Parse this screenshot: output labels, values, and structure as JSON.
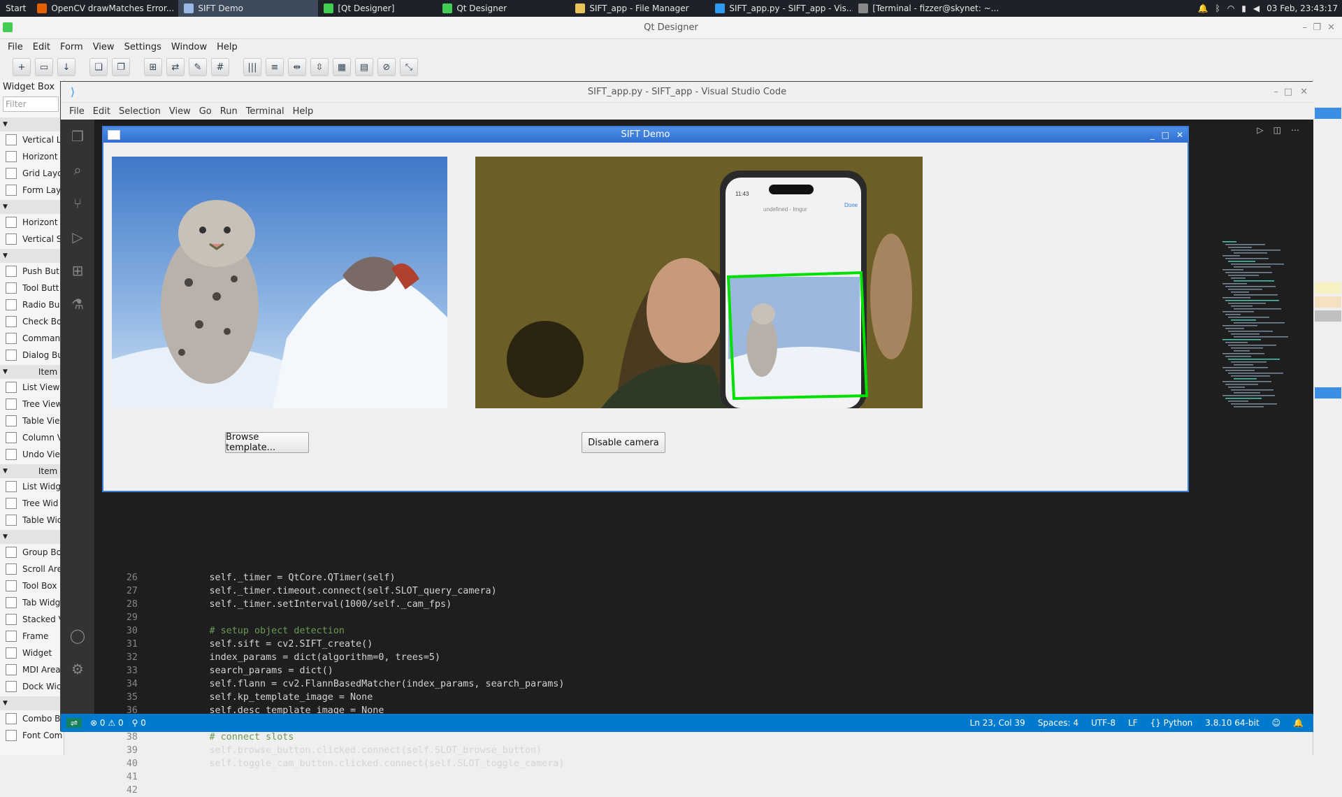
{
  "taskbar": {
    "start": "Start",
    "tasks": [
      {
        "label": "OpenCV drawMatches Error...",
        "icon": "firefox-icon",
        "color": "#e66000"
      },
      {
        "label": "SIFT Demo",
        "icon": "window-icon",
        "color": "#9ab8e6",
        "active": true
      },
      {
        "label": "[Qt Designer]",
        "icon": "qt-icon",
        "color": "#41cd52"
      },
      {
        "label": "Qt Designer",
        "icon": "qt-icon",
        "color": "#41cd52"
      },
      {
        "label": "SIFT_app - File Manager",
        "icon": "folder-icon",
        "color": "#e8c35a"
      },
      {
        "label": "SIFT_app.py - SIFT_app - Vis...",
        "icon": "vscode-icon",
        "color": "#2e9bf0"
      },
      {
        "label": "[Terminal - fizzer@skynet: ~...",
        "icon": "terminal-icon",
        "color": "#888888"
      }
    ],
    "clock": "03 Feb, 23:43:17"
  },
  "qt_designer": {
    "title": "Qt Designer",
    "menu": [
      "File",
      "Edit",
      "Form",
      "View",
      "Settings",
      "Window",
      "Help"
    ],
    "widget_box": {
      "title": "Widget Box",
      "filter_placeholder": "Filter",
      "sections": [
        {
          "label": "",
          "items": [
            "Vertical L",
            "Horizont",
            "Grid Layo",
            "Form Lay"
          ]
        },
        {
          "label": "",
          "items": [
            "Horizont",
            "Vertical S"
          ]
        },
        {
          "label": "",
          "items": [
            "Push But",
            "Tool Butt",
            "Radio Bu",
            "Check Bo",
            "Comman",
            "Dialog Bu"
          ]
        },
        {
          "label": "Item",
          "items": [
            "List View",
            "Tree View",
            "Table Vie",
            "Column V",
            "Undo Vie"
          ]
        },
        {
          "label": "Item",
          "items": [
            "List Widg",
            "Tree Wid",
            "Table Wic"
          ]
        },
        {
          "label": "",
          "items": [
            "Group Bo",
            "Scroll Are",
            "Tool Box",
            "Tab Widg",
            "Stacked V",
            "Frame",
            "Widget",
            "MDI Area",
            "Dock Wic"
          ]
        },
        {
          "label": "",
          "items": [
            "Combo B",
            "Font Com"
          ]
        }
      ]
    }
  },
  "vscode": {
    "title": "SIFT_app.py - SIFT_app - Visual Studio Code",
    "menu": [
      "File",
      "Edit",
      "Selection",
      "View",
      "Go",
      "Run",
      "Terminal",
      "Help"
    ],
    "code": [
      {
        "n": "26",
        "t": "        self._timer = QtCore.QTimer(self)"
      },
      {
        "n": "27",
        "t": "        self._timer.timeout.connect(self.SLOT_query_camera)"
      },
      {
        "n": "28",
        "t": "        self._timer.setInterval(1000/self._cam_fps)"
      },
      {
        "n": "29",
        "t": ""
      },
      {
        "n": "30",
        "t": "        # setup object detection"
      },
      {
        "n": "31",
        "t": "        self.sift = cv2.SIFT_create()"
      },
      {
        "n": "32",
        "t": "        index_params = dict(algorithm=0, trees=5)"
      },
      {
        "n": "33",
        "t": "        search_params = dict()"
      },
      {
        "n": "34",
        "t": "        self.flann = cv2.FlannBasedMatcher(index_params, search_params)"
      },
      {
        "n": "35",
        "t": "        self.kp_template_image = None"
      },
      {
        "n": "36",
        "t": "        self.desc_template_image = None"
      },
      {
        "n": "37",
        "t": ""
      },
      {
        "n": "38",
        "t": "        # connect slots"
      },
      {
        "n": "39",
        "t": "        self.browse_button.clicked.connect(self.SLOT_browse_button)"
      },
      {
        "n": "40",
        "t": "        self.toggle_cam_button.clicked.connect(self.SLOT_toggle_camera)"
      },
      {
        "n": "41",
        "t": ""
      },
      {
        "n": "42",
        "t": ""
      }
    ],
    "status": {
      "problems": "⊗ 0 ⚠ 0",
      "ports": "⚲ 0",
      "position": "Ln 23, Col 39",
      "spaces": "Spaces: 4",
      "encoding": "UTF-8",
      "eol": "LF",
      "language": "{} Python",
      "interpreter": "3.8.10 64-bit"
    }
  },
  "sift_demo": {
    "title": "SIFT Demo",
    "browse_label": "Browse template...",
    "camera_label": "Disable camera"
  },
  "colors": {
    "accent": "#007acc",
    "match_box": "#00e000",
    "dialog_title": "#3a7ad8"
  }
}
